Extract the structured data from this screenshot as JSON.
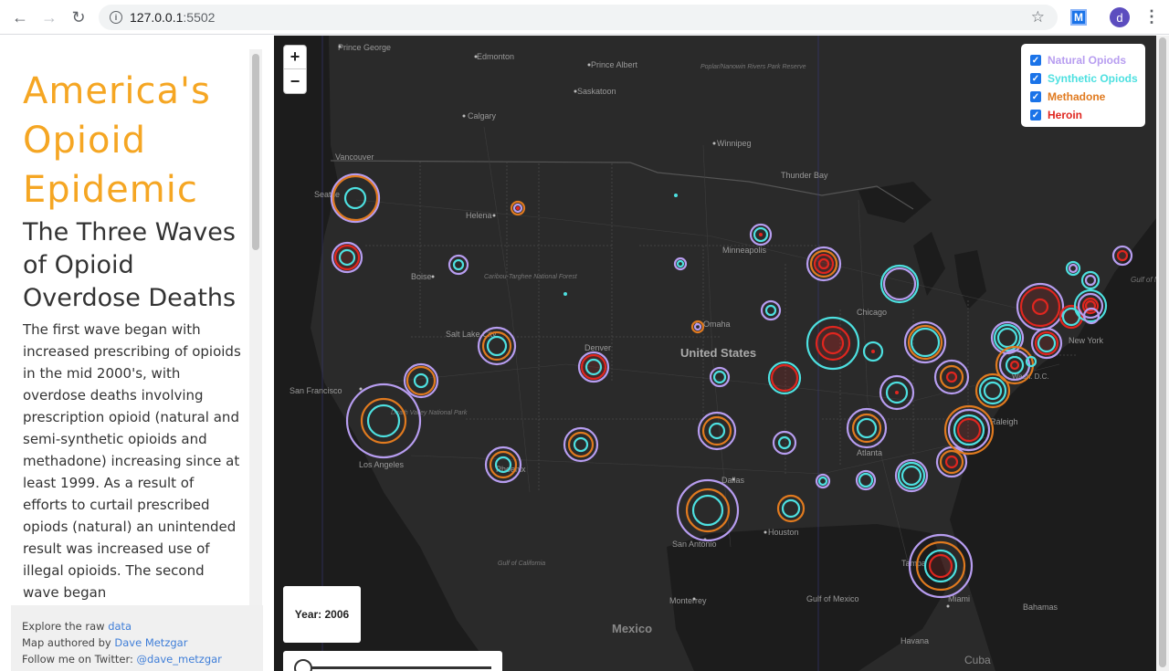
{
  "browser": {
    "url_host": "127.0.0.1",
    "url_port": ":5502",
    "extension_label": "M",
    "avatar_letter": "d"
  },
  "sidebar": {
    "title": "America's Opioid Epidemic",
    "subtitle": "The Three Waves of Opioid Overdose Deaths",
    "body": "The first wave began with increased prescribing of opioids in the mid 2000's, with overdose deaths involving prescription opioid (natural and semi-synthetic opioids and methadone) increasing since at least 1999. As a result of efforts to curtail prescribed opiods (natural) an unintended result was increased use of illegal opioids. The second wave began",
    "footer": {
      "line1_prefix": "Explore the raw ",
      "line1_link": "data",
      "line2_prefix": "Map authored by ",
      "line2_link": "Dave Metzgar",
      "line3_prefix": "Follow me on Twitter: ",
      "line3_link": "@dave_metzgar"
    }
  },
  "map": {
    "zoom_in": "+",
    "zoom_out": "−",
    "legend": [
      {
        "label": "Natural Opiods",
        "color": "#b79df0",
        "checked": true
      },
      {
        "label": "Synthetic Opiods",
        "color": "#4de0e0",
        "checked": true
      },
      {
        "label": "Methadone",
        "color": "#e07a1f",
        "checked": true
      },
      {
        "label": "Heroin",
        "color": "#e0261f",
        "checked": true
      }
    ],
    "year_label": "Year: 2006",
    "slider_value": 0,
    "colors": {
      "natural": "#b79df0",
      "synthetic": "#4de0e0",
      "methadone": "#e07a1f",
      "heroin": "#e0261f"
    },
    "place_labels": [
      "Prince George",
      "Edmonton",
      "Prince Albert",
      "Saskatoon",
      "Calgary",
      "Winnipeg",
      "Thunder Bay",
      "Vancouver",
      "Seattle",
      "Helena",
      "Boise",
      "Minneapolis",
      "Chicago",
      "Omaha",
      "Denver",
      "Salt Lake City",
      "San Francisco",
      "Los Angeles",
      "Phoenix",
      "Dallas",
      "San Antonio",
      "Houston",
      "Atlanta",
      "Raleigh",
      "New York",
      "Tampa",
      "Miami",
      "Monterrey",
      "Gulf of Mexico",
      "Bahamas",
      "Havana",
      "Cuba",
      "Mexico",
      "United States",
      "Caribou-Targhee National Forest",
      "Death Valley National Park",
      "Poplar/Nanowin Rivers Park Reserve",
      "Gulf of California",
      "Gulf of Maine",
      "Wash. D.C."
    ]
  }
}
